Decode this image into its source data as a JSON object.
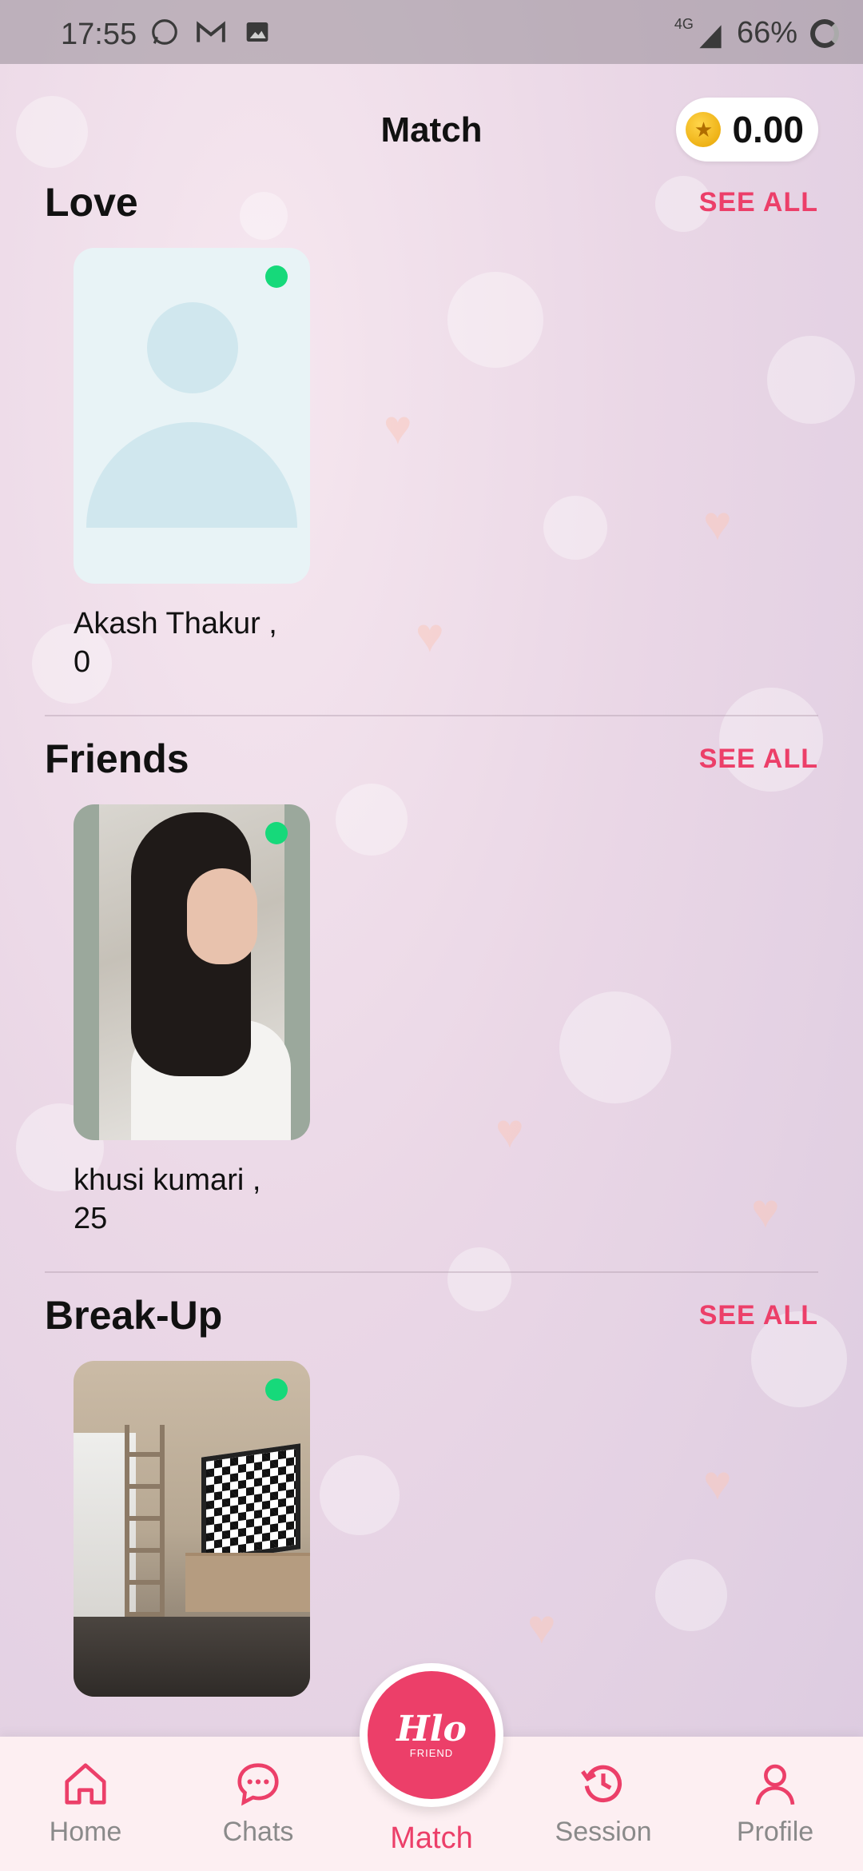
{
  "status_bar": {
    "time": "17:55",
    "network": "4G",
    "battery": "66%"
  },
  "header": {
    "title": "Match",
    "coin_balance": "0.00",
    "coin_icon": "star-coin-icon"
  },
  "sections": [
    {
      "title": "Love",
      "see_all": "SEE ALL",
      "card": {
        "name_line1": "Akash Thakur ,",
        "name_line2": "0",
        "online": true
      }
    },
    {
      "title": "Friends",
      "see_all": "SEE ALL",
      "card": {
        "name_line1": "khusi kumari ,",
        "name_line2": "25",
        "online": true
      }
    },
    {
      "title": "Break-Up",
      "see_all": "SEE ALL",
      "card": {
        "online": true
      }
    }
  ],
  "bottom_nav": {
    "items": [
      {
        "label": "Home",
        "icon": "home-icon"
      },
      {
        "label": "Chats",
        "icon": "chat-bubble-icon"
      },
      {
        "label": "Match",
        "icon": "match-logo-icon",
        "active": true
      },
      {
        "label": "Session",
        "icon": "history-icon"
      },
      {
        "label": "Profile",
        "icon": "user-icon"
      }
    ],
    "fab_logo_text": "Hlo",
    "fab_logo_sub": "FRIEND"
  },
  "colors": {
    "accent": "#ec3f69",
    "online": "#16d97a",
    "inactive": "#8a8a8a"
  }
}
